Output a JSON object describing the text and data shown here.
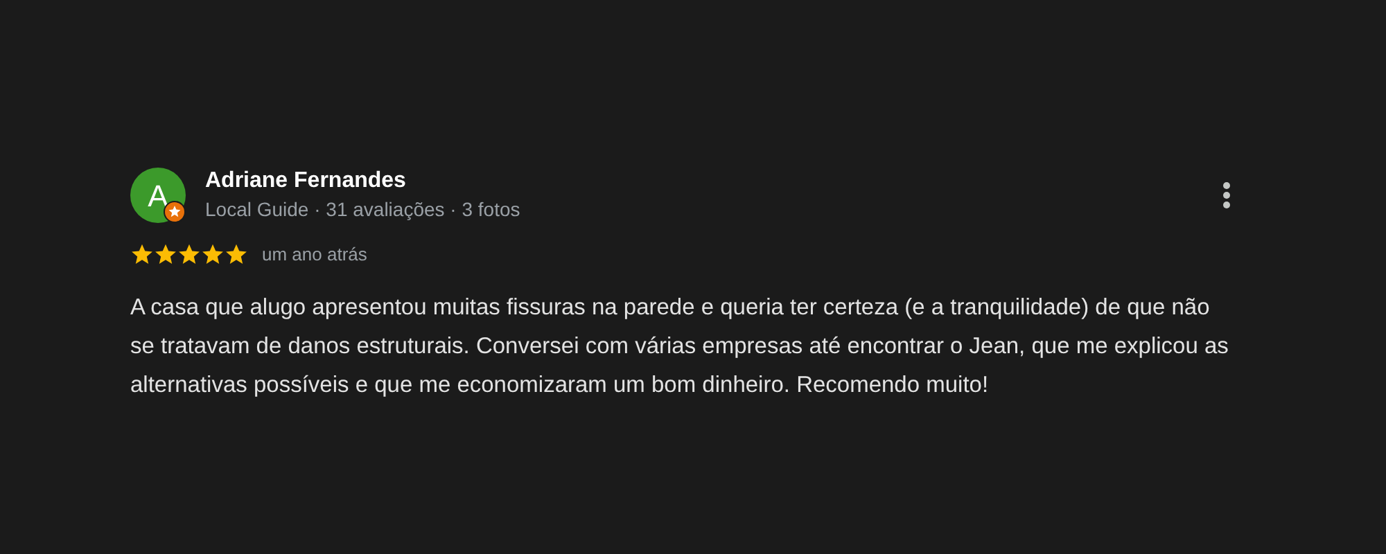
{
  "review": {
    "avatar_letter": "A",
    "local_guide": true,
    "author": "Adriane Fernandes",
    "meta": "Local Guide · 31 avaliações · 3 fotos",
    "stars": 5,
    "time": "um ano atrás",
    "text": "A casa que alugo apresentou muitas fissuras na parede e queria ter certeza (e a tranquilidade) de que não se tratavam de danos estruturais. Conversei com várias empresas até encontrar o Jean, que me explicou as alternativas possíveis e que me economizaram um bom dinheiro. Recomendo muito!"
  }
}
